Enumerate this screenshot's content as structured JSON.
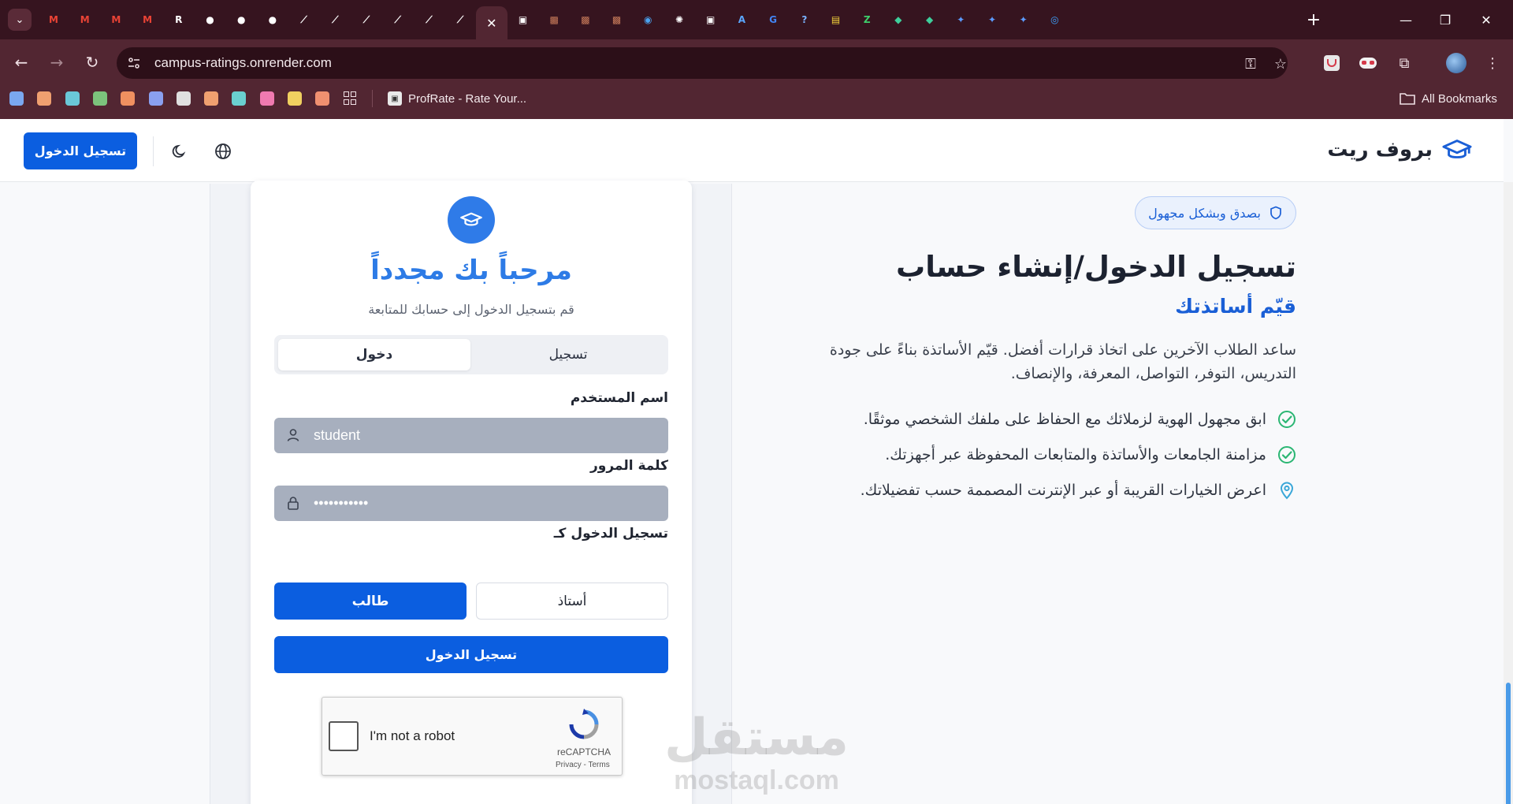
{
  "browser": {
    "url": "campus-ratings.onrender.com",
    "bookmark_page_title": "ProfRate - Rate Your...",
    "all_bookmarks_label": "All Bookmarks",
    "tabs": [
      {
        "icon": "gmail-icon",
        "glyph": "M",
        "color": "#ea4335"
      },
      {
        "icon": "gmail-icon",
        "glyph": "M",
        "color": "#ea4335"
      },
      {
        "icon": "gmail-icon",
        "glyph": "M",
        "color": "#ea4335"
      },
      {
        "icon": "gmail-icon",
        "glyph": "M",
        "color": "#ea4335"
      },
      {
        "icon": "r-app-icon",
        "glyph": "R",
        "color": "#ffffff"
      },
      {
        "icon": "github-icon",
        "glyph": "●",
        "color": "#ffffff"
      },
      {
        "icon": "github-icon",
        "glyph": "●",
        "color": "#ffffff"
      },
      {
        "icon": "github-icon",
        "glyph": "●",
        "color": "#ffffff"
      },
      {
        "icon": "render-icon",
        "glyph": "⟋",
        "color": "#ffffff"
      },
      {
        "icon": "render-icon",
        "glyph": "⟋",
        "color": "#ffffff"
      },
      {
        "icon": "render-icon",
        "glyph": "⟋",
        "color": "#ffffff"
      },
      {
        "icon": "render-icon",
        "glyph": "⟋",
        "color": "#ffffff"
      },
      {
        "icon": "render-icon",
        "glyph": "⟋",
        "color": "#ffffff"
      },
      {
        "icon": "render-icon",
        "glyph": "⟋",
        "color": "#ffffff"
      },
      {
        "icon": "active-tab-close-icon",
        "glyph": "✕",
        "color": "#ffffff"
      },
      {
        "icon": "profrate-icon",
        "glyph": "▣",
        "color": "#ffffff"
      },
      {
        "icon": "photo-icon",
        "glyph": "▩",
        "color": "#c87b5a"
      },
      {
        "icon": "photo-icon",
        "glyph": "▩",
        "color": "#c87b5a"
      },
      {
        "icon": "photo-icon",
        "glyph": "▩",
        "color": "#c87b5a"
      },
      {
        "icon": "blue-app-icon",
        "glyph": "◉",
        "color": "#4aa3f0"
      },
      {
        "icon": "openai-icon",
        "glyph": "✺",
        "color": "#ffffff"
      },
      {
        "icon": "profrate-icon",
        "glyph": "▣",
        "color": "#ffffff"
      },
      {
        "icon": "a-app-icon",
        "glyph": "A",
        "color": "#5aa6ff"
      },
      {
        "icon": "google-icon",
        "glyph": "G",
        "color": "#4285f4"
      },
      {
        "icon": "help-icon",
        "glyph": "?",
        "color": "#7ab3ff"
      },
      {
        "icon": "yellow-app-icon",
        "glyph": "▤",
        "color": "#f3d23b"
      },
      {
        "icon": "green-app-icon",
        "glyph": "Z",
        "color": "#3ecf6b"
      },
      {
        "icon": "tag-icon",
        "glyph": "◆",
        "color": "#3ecf9b"
      },
      {
        "icon": "tag-icon",
        "glyph": "◆",
        "color": "#3ecf9b"
      },
      {
        "icon": "gemini-icon",
        "glyph": "✦",
        "color": "#5c9bff"
      },
      {
        "icon": "gemini-icon",
        "glyph": "✦",
        "color": "#5c9bff"
      },
      {
        "icon": "gemini-icon",
        "glyph": "✦",
        "color": "#5c9bff"
      },
      {
        "icon": "blue-circle-icon",
        "glyph": "◎",
        "color": "#3da3ff"
      }
    ],
    "bookmark_colors": [
      "#7aa8f0",
      "#f0a070",
      "#6ac8d8",
      "#7cc37c",
      "#f09060",
      "#8aa0f0",
      "#e0e0e0",
      "#f0a070",
      "#6ad0d0",
      "#f07ab0",
      "#f0d060",
      "#f09070"
    ]
  },
  "header": {
    "brand_name": "بروف ريت",
    "login_button": "تسجيل الدخول"
  },
  "info": {
    "badge": "بصدق وبشكل مجهول",
    "title": "تسجيل الدخول/إنشاء حساب",
    "subtitle": "قيّم أساتذتك",
    "description": "ساعد الطلاب الآخرين على اتخاذ قرارات أفضل. قيّم الأساتذة بناءً على جودة التدريس، التوفر، التواصل، المعرفة، والإنصاف.",
    "features": [
      {
        "icon": "check-circle-icon",
        "text": "ابق مجهول الهوية لزملائك مع الحفاظ على ملفك الشخصي موثقًا."
      },
      {
        "icon": "check-circle-icon",
        "text": "مزامنة الجامعات والأساتذة والمتابعات المحفوظة عبر أجهزتك."
      },
      {
        "icon": "map-pin-icon",
        "text": "اعرض الخيارات القريبة أو عبر الإنترنت المصممة حسب تفضيلاتك."
      }
    ]
  },
  "card": {
    "welcome": "مرحباً بك مجدداً",
    "subtitle": "قم بتسجيل الدخول إلى حسابك للمتابعة",
    "tab_login": "دخول",
    "tab_register": "تسجيل",
    "username_label": "اسم المستخدم",
    "username_value": "student",
    "password_label": "كلمة المرور",
    "password_value": "•••••••••••",
    "role_label": "تسجيل الدخول كـ",
    "role_professor": "أستاذ",
    "role_student": "طالب",
    "submit": "تسجيل الدخول"
  },
  "recaptcha": {
    "label": "I'm not a robot",
    "brand": "reCAPTCHA",
    "links": "Privacy - Terms"
  },
  "watermark": {
    "arabic": "مستقل",
    "latin": "mostaql.com"
  },
  "colors": {
    "primary": "#0b5ee0",
    "accent": "#1a5fd6",
    "check": "#2bb673",
    "pin": "#3aa7d8",
    "chrome": "#522632"
  }
}
